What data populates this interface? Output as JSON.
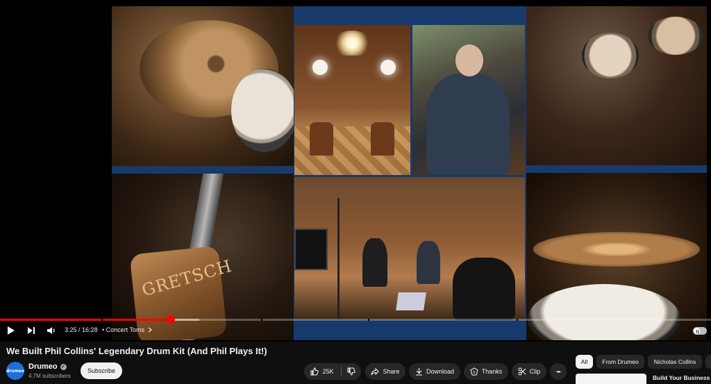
{
  "player": {
    "time_current": "3:25",
    "time_separator": " / ",
    "time_total": "16:28",
    "chapter_bullet": "•",
    "chapter": "Concert Toms",
    "progress_played_fraction": 0.24,
    "progress_buffered_fraction": 0.28,
    "autoplay_on": false,
    "video_art": {
      "badge_text": "GRETSCH"
    }
  },
  "video": {
    "title": "We Built Phil Collins' Legendary Drum Kit (And Phil Plays It!)"
  },
  "channel": {
    "avatar_text": "drumeo",
    "name": "Drumeo",
    "subscribers": "4.7M subscribers",
    "subscribe_label": "Subscribe"
  },
  "actions": {
    "like_count": "25K",
    "share_label": "Share",
    "download_label": "Download",
    "thanks_label": "Thanks",
    "clip_label": "Clip",
    "more_label": "•••"
  },
  "recommendations": {
    "chips": [
      "All",
      "From Drumeo",
      "Nicholas Collins"
    ],
    "first_title": "Build Your Business w"
  },
  "colors": {
    "background": "#0f0f0f",
    "progress_red": "#ff0000",
    "pill_bg": "#272727",
    "subscribe_bg": "#f1f1f1",
    "collage_border": "#173a6b"
  }
}
